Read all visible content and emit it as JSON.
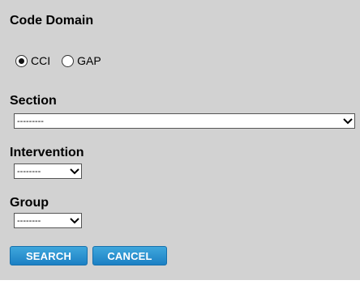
{
  "form": {
    "title": "Code Domain",
    "code_domain_options": [
      {
        "label": "CCI",
        "selected": true
      },
      {
        "label": "GAP",
        "selected": false
      }
    ],
    "section": {
      "label": "Section",
      "value": "---------"
    },
    "intervention": {
      "label": "Intervention",
      "value": "--------"
    },
    "group": {
      "label": "Group",
      "value": "--------"
    }
  },
  "buttons": {
    "search": "SEARCH",
    "cancel": "CANCEL"
  },
  "colors": {
    "panel_bg": "#d2d2d2",
    "button_bg": "#2a90cf",
    "button_text": "#ffffff"
  },
  "icons": {
    "dropdown": "chevron-down-icon"
  }
}
